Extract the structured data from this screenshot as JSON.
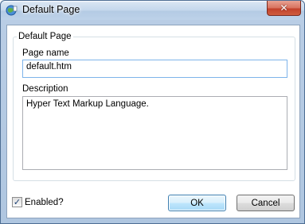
{
  "window": {
    "title": "Default Page",
    "close_glyph": "✕"
  },
  "group": {
    "label": "Default Page"
  },
  "page_name": {
    "label": "Page name",
    "value": "default.htm"
  },
  "description": {
    "label": "Description",
    "value": "Hyper Text Markup Language."
  },
  "enabled": {
    "label": "Enabled?",
    "checked": true,
    "check_glyph": "✓"
  },
  "buttons": {
    "ok": "OK",
    "cancel": "Cancel"
  },
  "icons": {
    "app": "globe-page-icon",
    "close": "close-icon",
    "check": "checkmark-icon"
  },
  "colors": {
    "title_bar": "#c4d7ec",
    "close_button": "#c2412b",
    "ok_border": "#3c7fb1",
    "focus_border": "#7eb4ea"
  }
}
